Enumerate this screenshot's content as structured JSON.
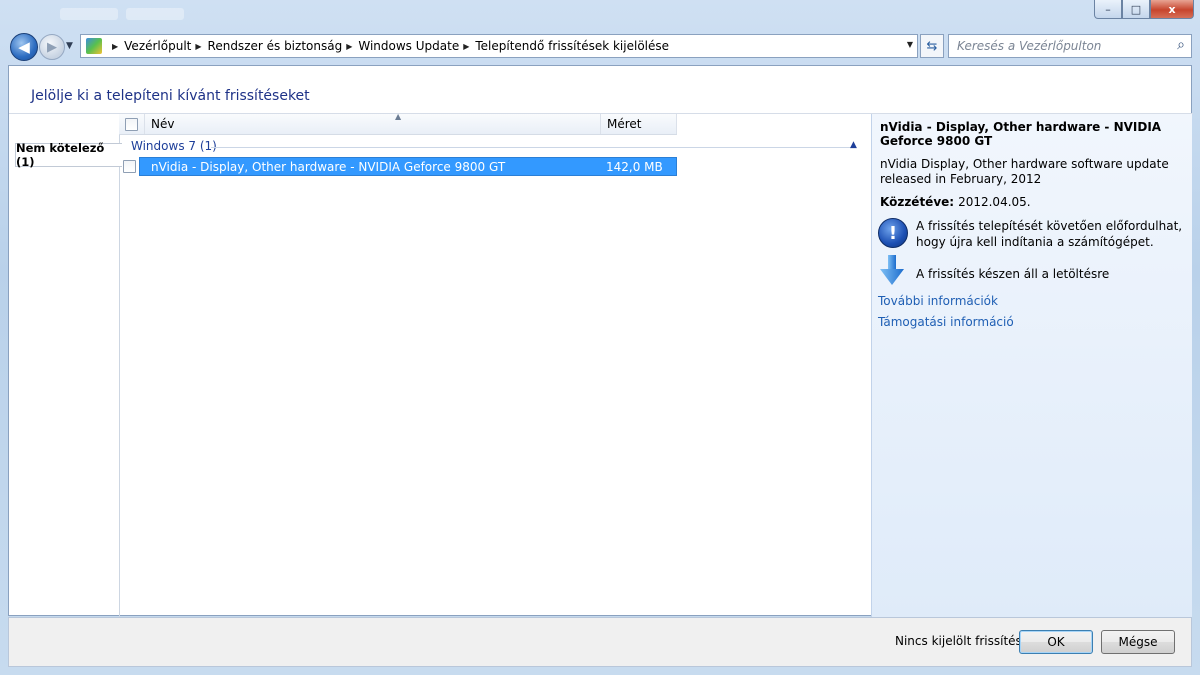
{
  "window": {
    "caption_buttons": {
      "minimize": "–",
      "maximize": "□",
      "close": "x"
    }
  },
  "navigation": {
    "back_icon": "back-arrow-icon",
    "forward_icon": "forward-arrow-icon",
    "breadcrumbs": [
      "Vezérlőpult",
      "Rendszer és biztonság",
      "Windows Update",
      "Telepítendő frissítések kijelölése"
    ],
    "search_placeholder": "Keresés a Vezérlőpulton"
  },
  "page": {
    "heading": "Jelölje ki a telepíteni kívánt frissítéseket",
    "tabs": [
      {
        "label": "Nem kötelező (1)",
        "selected": true
      }
    ]
  },
  "list": {
    "columns": {
      "name": "Név",
      "size": "Méret"
    },
    "group": {
      "label": "Windows 7 (1)"
    },
    "rows": [
      {
        "name": "nVidia - Display, Other hardware - NVIDIA Geforce 9800 GT",
        "size": "142,0 MB",
        "checked": false,
        "selected": true
      }
    ]
  },
  "details": {
    "title": "nVidia - Display, Other hardware - NVIDIA Geforce 9800 GT",
    "description": "nVidia Display, Other hardware software update released in February, 2012",
    "published_label": "Közzétéve:",
    "published_value": "2012.04.05.",
    "restart_note": "A frissítés telepítését követően előfordulhat, hogy újra kell indítania a számítógépet.",
    "download_note": "A frissítés készen áll a letöltésre",
    "links": [
      "További információk",
      "Támogatási információ"
    ]
  },
  "footer": {
    "status": "Nincs kijelölt frissítés.",
    "ok_label": "OK",
    "cancel_label": "Mégse"
  },
  "colors": {
    "accent": "#1e3287",
    "selection": "#3399ff",
    "link": "#1f5fb4"
  }
}
